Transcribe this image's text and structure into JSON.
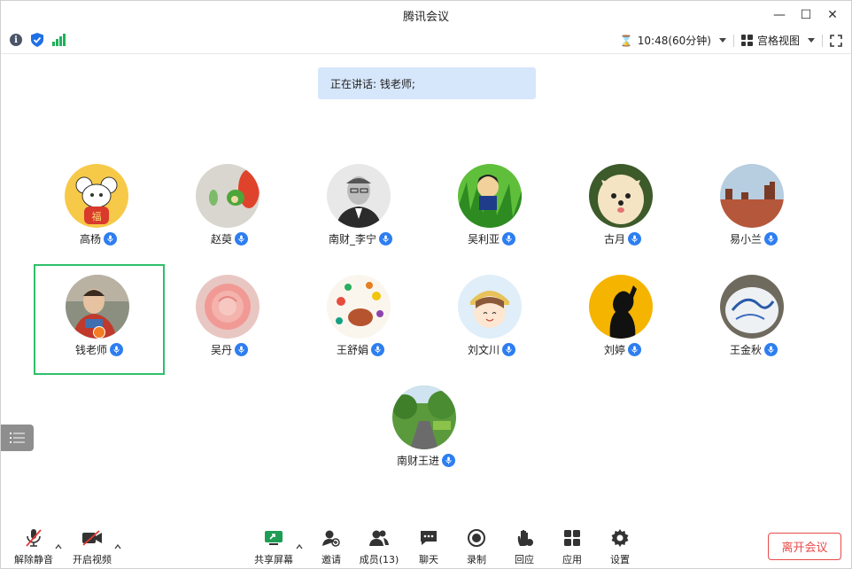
{
  "window": {
    "title": "腾讯会议"
  },
  "status": {
    "time": "10:48(60分钟)",
    "view_mode": "宫格视图"
  },
  "speaking_banner": "正在讲话: 钱老师;",
  "participants": [
    {
      "name": "高杨"
    },
    {
      "name": "赵萸"
    },
    {
      "name": "南财_李宁"
    },
    {
      "name": "吴利亚"
    },
    {
      "name": "古月"
    },
    {
      "name": "易小兰"
    },
    {
      "name": "钱老师"
    },
    {
      "name": "吴丹"
    },
    {
      "name": "王舒娟"
    },
    {
      "name": "刘文川"
    },
    {
      "name": "刘婷"
    },
    {
      "name": "王金秋"
    },
    {
      "name": "南财王进"
    }
  ],
  "toolbar": {
    "unmute": "解除静音",
    "start_video": "开启视频",
    "share_screen": "共享屏幕",
    "invite": "邀请",
    "members": "成员(13)",
    "chat": "聊天",
    "record": "录制",
    "react": "回应",
    "apps": "应用",
    "settings": "设置",
    "leave": "离开会议"
  },
  "colors": {
    "accent": "#2d7ef0",
    "active_border": "#2fbf6a",
    "leave": "#e84a4a",
    "banner": "#d6e6fb"
  }
}
